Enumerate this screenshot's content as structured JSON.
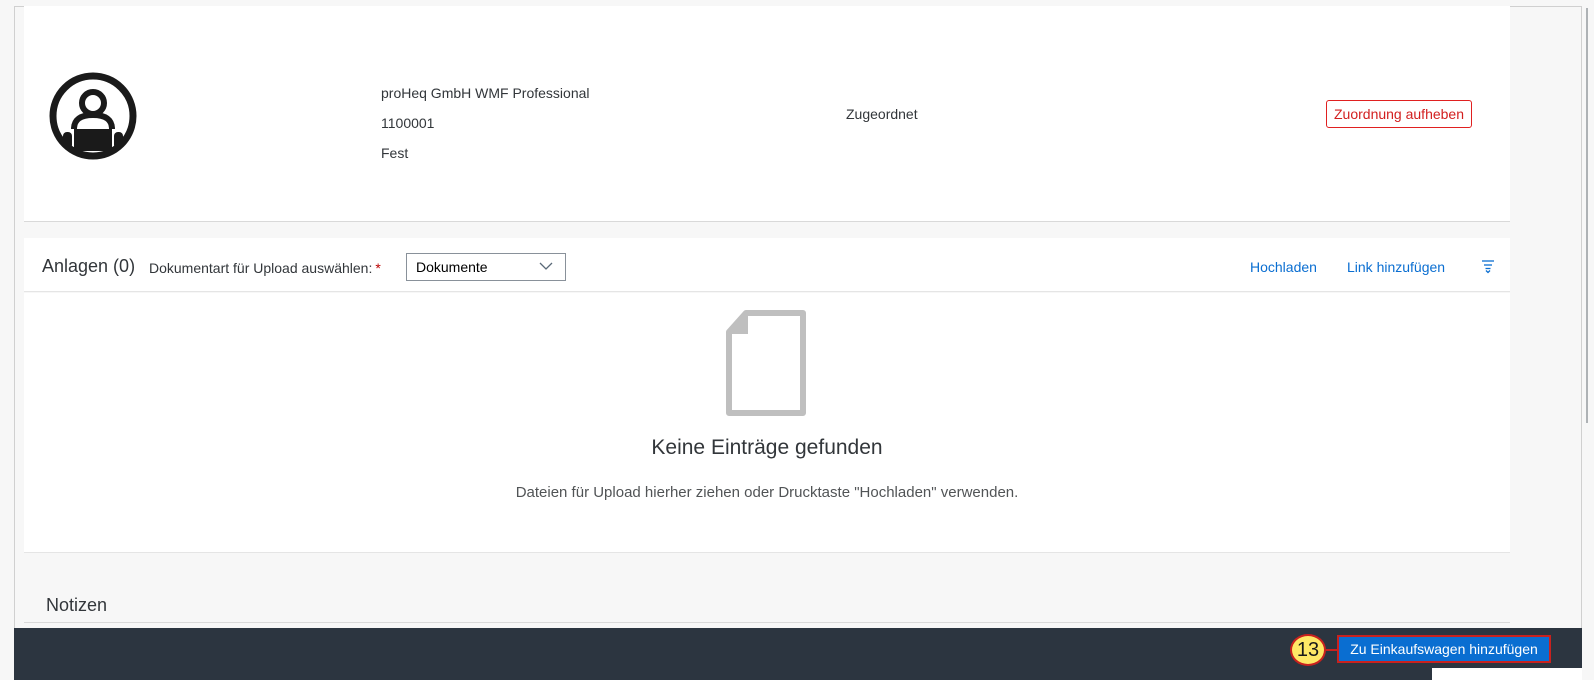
{
  "supplier": {
    "avatar_icon": "user-circle-icon",
    "name": "proHeq GmbH WMF Professional",
    "number": "1100001",
    "type": "Fest",
    "status": "Zugeordnet",
    "unassign_label": "Zuordnung aufheben"
  },
  "attachments": {
    "title": "Anlagen (0)",
    "doctype_label": "Dokumentart für Upload auswählen:",
    "required_marker": "*",
    "doctype_value": "Dokumente",
    "upload_label": "Hochladen",
    "add_link_label": "Link hinzufügen",
    "settings_icon": "filter-icon",
    "empty_icon": "document-icon",
    "empty_title": "Keine Einträge gefunden",
    "empty_hint": "Dateien für Upload hierher ziehen oder Drucktaste \"Hochladen\" verwenden."
  },
  "notes": {
    "title": "Notizen"
  },
  "footer": {
    "step_number": "13",
    "add_to_cart_label": "Zu Einkaufswagen hinzufügen"
  },
  "colors": {
    "accent": "#0a6ed1",
    "danger": "#d21f1f",
    "footer_bg": "#2c3540",
    "highlight": "#ffe866"
  }
}
